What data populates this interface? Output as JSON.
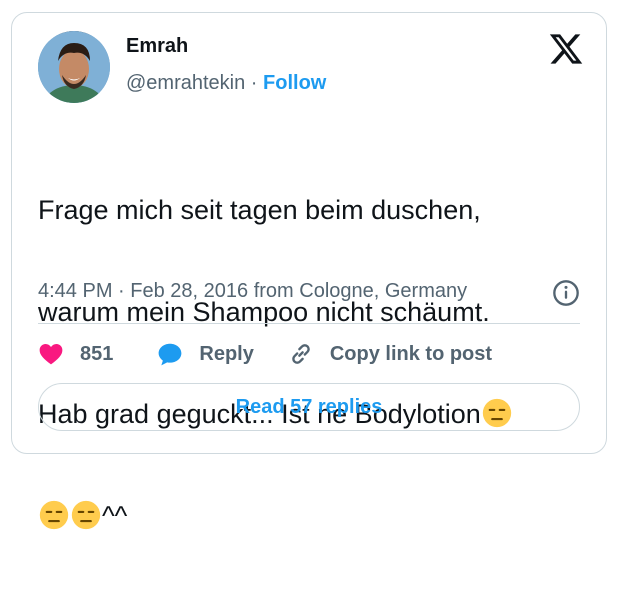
{
  "author": {
    "name": "Emrah",
    "handle": "@emrahtekin",
    "separator": " · ",
    "follow_label": "Follow"
  },
  "tweet": {
    "line1": "Frage mich seit tagen beim duschen,",
    "line2": "warum mein Shampoo nicht schäumt.",
    "line3": "Hab grad geguckt... Ist ne Bodylotion",
    "line4_suffix": "^^",
    "emoji": "expressionless-face"
  },
  "meta": {
    "time": "4:44 PM",
    "separator": " · ",
    "date": "Feb 28, 2016",
    "location": " from Cologne, Germany"
  },
  "actions": {
    "like_count": "851",
    "reply_label": "Reply",
    "copy_label": "Copy link to post"
  },
  "footer": {
    "read_replies_label": "Read 57 replies"
  },
  "colors": {
    "accent": "#1d9bf0",
    "like": "#f91880",
    "muted": "#536471",
    "border": "#cfd9de"
  }
}
